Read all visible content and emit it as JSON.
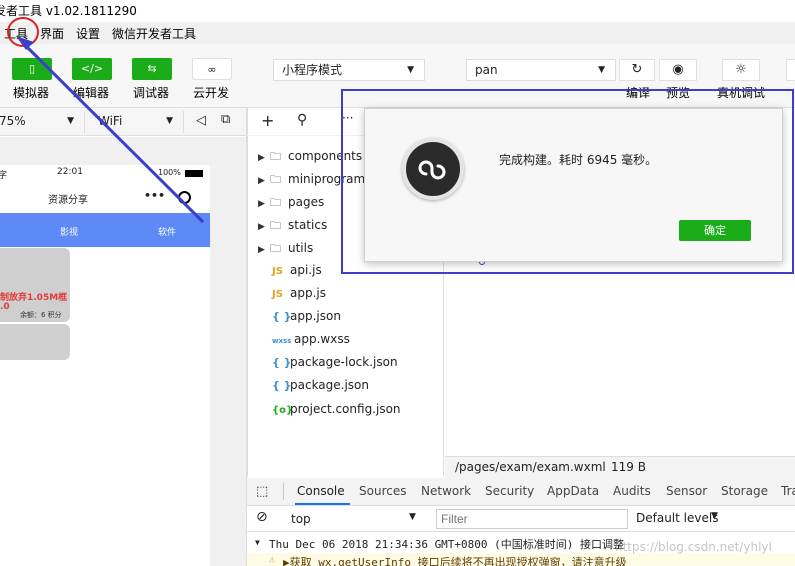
{
  "window": {
    "title": "发者工具 v1.02.1811290"
  },
  "menu": {
    "items": [
      "工具",
      "界面",
      "设置",
      "微信开发者工具"
    ]
  },
  "toolbar": {
    "buttons": [
      {
        "label": "模拟器",
        "icon": "phone-icon"
      },
      {
        "label": "编辑器",
        "icon": "code-icon"
      },
      {
        "label": "调试器",
        "icon": "debug-icon"
      },
      {
        "label": "云开发",
        "icon": "cloud-icon"
      }
    ],
    "mode_select": "小程序模式",
    "compile_select": "pan",
    "right_labels": [
      "编译",
      "预览",
      "真机调试"
    ]
  },
  "simulator": {
    "zoom": "75%",
    "network": "WiFi",
    "status_time": "22:01",
    "battery": "100%",
    "nav_title": "资源分享",
    "nav_dots": "•••",
    "tabs": [
      "影视",
      "软件"
    ],
    "cards": [
      {
        "title": "制放弃1.05M框",
        "sub": ".0",
        "meta": "余额：6 积分"
      },
      {
        "title": "",
        "sub": "",
        "meta": ""
      }
    ]
  },
  "files": [
    {
      "name": "components",
      "type": "folder"
    },
    {
      "name": "miniprogram_",
      "type": "folder"
    },
    {
      "name": "pages",
      "type": "folder"
    },
    {
      "name": "statics",
      "type": "folder"
    },
    {
      "name": "utils",
      "type": "folder"
    },
    {
      "name": "api.js",
      "type": "js"
    },
    {
      "name": "app.js",
      "type": "js"
    },
    {
      "name": "app.json",
      "type": "json"
    },
    {
      "name": "app.wxss",
      "type": "wxss"
    },
    {
      "name": "package-lock.json",
      "type": "json"
    },
    {
      "name": "package.json",
      "type": "json"
    },
    {
      "name": "project.config.json",
      "type": "config"
    }
  ],
  "editor": {
    "path": "/pages/exam/exam.wxml",
    "size": "119 B"
  },
  "devtools": {
    "tabs": [
      "Console",
      "Sources",
      "Network",
      "Security",
      "AppData",
      "Audits",
      "Sensor",
      "Storage",
      "Tra"
    ],
    "context": "top",
    "filter_placeholder": "Filter",
    "levels": "Default levels",
    "log1": "Thu Dec 06 2018 21:34:36 GMT+0800 (中国标准时间) 接口调整",
    "log2": "▶获取 wx.getUserInfo 接口后续将不再出现授权弹窗，请注意升级"
  },
  "dialog": {
    "message": "完成构建。耗时 6945 毫秒。",
    "ok_label": "确定"
  },
  "watermark": "https://blog.csdn.net/yhlyl",
  "colors": {
    "green": "#1aad19",
    "tab_blue": "#5d8af6",
    "annotation_blue": "#3e3ec9",
    "annotation_red": "#e02020"
  }
}
